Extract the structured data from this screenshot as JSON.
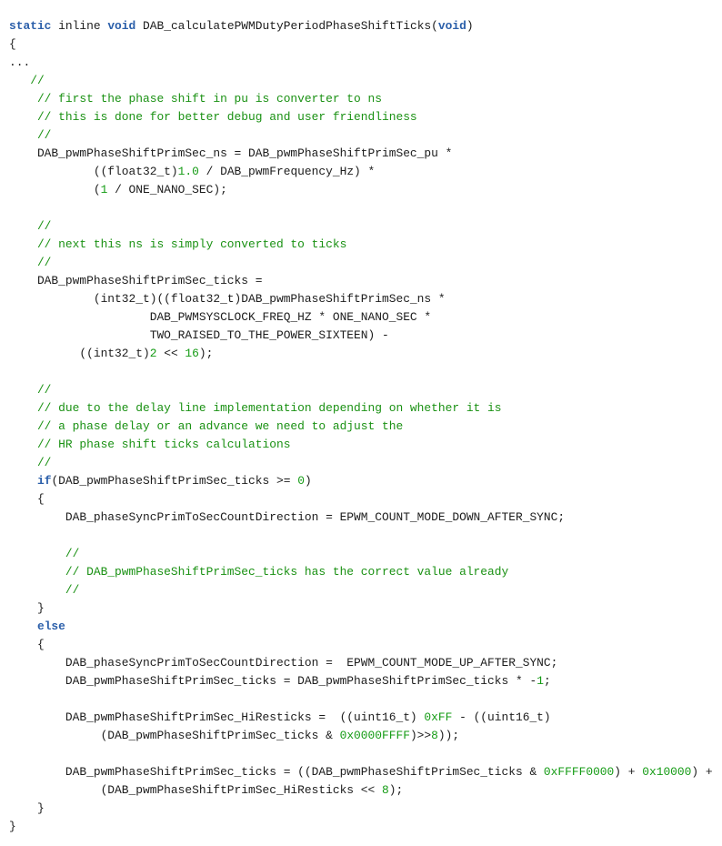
{
  "editor": {
    "language": "c",
    "function_name": "DAB_calculatePWMDutyPeriodPhaseShiftTicks",
    "background_color": "#ffffff",
    "colors": {
      "plain": "#1c1c1c",
      "keyword": "#2b5faa",
      "comment": "#1a9113",
      "number": "#149b14"
    }
  },
  "code": {
    "lines": [
      {
        "n": 1,
        "tokens": [
          {
            "t": "static",
            "c": "keyword"
          },
          {
            "t": " inline ",
            "c": "plain"
          },
          {
            "t": "void",
            "c": "keyword"
          },
          {
            "t": " DAB_calculatePWMDutyPeriodPhaseShiftTicks(",
            "c": "plain"
          },
          {
            "t": "void",
            "c": "keyword"
          },
          {
            "t": ")",
            "c": "plain"
          }
        ]
      },
      {
        "n": 2,
        "tokens": [
          {
            "t": "{",
            "c": "plain"
          }
        ]
      },
      {
        "n": 3,
        "tokens": [
          {
            "t": "...",
            "c": "plain"
          }
        ]
      },
      {
        "n": 4,
        "tokens": [
          {
            "t": "   //",
            "c": "comment"
          }
        ]
      },
      {
        "n": 5,
        "tokens": [
          {
            "t": "    // first the phase shift in pu is converter to ns",
            "c": "comment"
          }
        ]
      },
      {
        "n": 6,
        "tokens": [
          {
            "t": "    // this is done for better debug and user friendliness",
            "c": "comment"
          }
        ]
      },
      {
        "n": 7,
        "tokens": [
          {
            "t": "    //",
            "c": "comment"
          }
        ]
      },
      {
        "n": 8,
        "tokens": [
          {
            "t": "    DAB_pwmPhaseShiftPrimSec_ns = DAB_pwmPhaseShiftPrimSec_pu *",
            "c": "plain"
          }
        ]
      },
      {
        "n": 9,
        "tokens": [
          {
            "t": "            ((float32_t)",
            "c": "plain"
          },
          {
            "t": "1.0",
            "c": "number"
          },
          {
            "t": " / DAB_pwmFrequency_Hz) *",
            "c": "plain"
          }
        ]
      },
      {
        "n": 10,
        "tokens": [
          {
            "t": "            (",
            "c": "plain"
          },
          {
            "t": "1",
            "c": "number"
          },
          {
            "t": " / ONE_NANO_SEC);",
            "c": "plain"
          }
        ]
      },
      {
        "n": 11,
        "tokens": [
          {
            "t": "",
            "c": "plain"
          }
        ]
      },
      {
        "n": 12,
        "tokens": [
          {
            "t": "    //",
            "c": "comment"
          }
        ]
      },
      {
        "n": 13,
        "tokens": [
          {
            "t": "    // next this ns is simply converted to ticks",
            "c": "comment"
          }
        ]
      },
      {
        "n": 14,
        "tokens": [
          {
            "t": "    //",
            "c": "comment"
          }
        ]
      },
      {
        "n": 15,
        "tokens": [
          {
            "t": "    DAB_pwmPhaseShiftPrimSec_ticks =",
            "c": "plain"
          }
        ]
      },
      {
        "n": 16,
        "tokens": [
          {
            "t": "            (int32_t)((float32_t)DAB_pwmPhaseShiftPrimSec_ns *",
            "c": "plain"
          }
        ]
      },
      {
        "n": 17,
        "tokens": [
          {
            "t": "                    DAB_PWMSYSCLOCK_FREQ_HZ * ONE_NANO_SEC *",
            "c": "plain"
          }
        ]
      },
      {
        "n": 18,
        "tokens": [
          {
            "t": "                    TWO_RAISED_TO_THE_POWER_SIXTEEN) -",
            "c": "plain"
          }
        ]
      },
      {
        "n": 19,
        "tokens": [
          {
            "t": "          ((int32_t)",
            "c": "plain"
          },
          {
            "t": "2",
            "c": "number"
          },
          {
            "t": " << ",
            "c": "plain"
          },
          {
            "t": "16",
            "c": "number"
          },
          {
            "t": ");",
            "c": "plain"
          }
        ]
      },
      {
        "n": 20,
        "tokens": [
          {
            "t": "",
            "c": "plain"
          }
        ]
      },
      {
        "n": 21,
        "tokens": [
          {
            "t": "    //",
            "c": "comment"
          }
        ]
      },
      {
        "n": 22,
        "tokens": [
          {
            "t": "    // due to the delay line implementation depending on whether it is",
            "c": "comment"
          }
        ]
      },
      {
        "n": 23,
        "tokens": [
          {
            "t": "    // a phase delay or an advance we need to adjust the",
            "c": "comment"
          }
        ]
      },
      {
        "n": 24,
        "tokens": [
          {
            "t": "    // HR phase shift ticks calculations",
            "c": "comment"
          }
        ]
      },
      {
        "n": 25,
        "tokens": [
          {
            "t": "    //",
            "c": "comment"
          }
        ]
      },
      {
        "n": 26,
        "tokens": [
          {
            "t": "    ",
            "c": "plain"
          },
          {
            "t": "if",
            "c": "keyword"
          },
          {
            "t": "(DAB_pwmPhaseShiftPrimSec_ticks >= ",
            "c": "plain"
          },
          {
            "t": "0",
            "c": "number"
          },
          {
            "t": ")",
            "c": "plain"
          }
        ]
      },
      {
        "n": 27,
        "tokens": [
          {
            "t": "    {",
            "c": "plain"
          }
        ]
      },
      {
        "n": 28,
        "tokens": [
          {
            "t": "        DAB_phaseSyncPrimToSecCountDirection = EPWM_COUNT_MODE_DOWN_AFTER_SYNC;",
            "c": "plain"
          }
        ]
      },
      {
        "n": 29,
        "tokens": [
          {
            "t": "",
            "c": "plain"
          }
        ]
      },
      {
        "n": 30,
        "tokens": [
          {
            "t": "        //",
            "c": "comment"
          }
        ]
      },
      {
        "n": 31,
        "tokens": [
          {
            "t": "        // DAB_pwmPhaseShiftPrimSec_ticks has the correct value already",
            "c": "comment"
          }
        ]
      },
      {
        "n": 32,
        "tokens": [
          {
            "t": "        //",
            "c": "comment"
          }
        ]
      },
      {
        "n": 33,
        "tokens": [
          {
            "t": "    }",
            "c": "plain"
          }
        ]
      },
      {
        "n": 34,
        "tokens": [
          {
            "t": "    ",
            "c": "plain"
          },
          {
            "t": "else",
            "c": "keyword"
          }
        ]
      },
      {
        "n": 35,
        "tokens": [
          {
            "t": "    {",
            "c": "plain"
          }
        ]
      },
      {
        "n": 36,
        "tokens": [
          {
            "t": "        DAB_phaseSyncPrimToSecCountDirection =  EPWM_COUNT_MODE_UP_AFTER_SYNC;",
            "c": "plain"
          }
        ]
      },
      {
        "n": 37,
        "tokens": [
          {
            "t": "        DAB_pwmPhaseShiftPrimSec_ticks = DAB_pwmPhaseShiftPrimSec_ticks * -",
            "c": "plain"
          },
          {
            "t": "1",
            "c": "number"
          },
          {
            "t": ";",
            "c": "plain"
          }
        ]
      },
      {
        "n": 38,
        "tokens": [
          {
            "t": "",
            "c": "plain"
          }
        ]
      },
      {
        "n": 39,
        "tokens": [
          {
            "t": "        DAB_pwmPhaseShiftPrimSec_HiResticks =  ((uint16_t) ",
            "c": "plain"
          },
          {
            "t": "0xFF",
            "c": "number"
          },
          {
            "t": " - ((uint16_t)",
            "c": "plain"
          }
        ]
      },
      {
        "n": 40,
        "tokens": [
          {
            "t": "             (DAB_pwmPhaseShiftPrimSec_ticks & ",
            "c": "plain"
          },
          {
            "t": "0x0000FFFF",
            "c": "number"
          },
          {
            "t": ")>>",
            "c": "plain"
          },
          {
            "t": "8",
            "c": "number"
          },
          {
            "t": "));",
            "c": "plain"
          }
        ]
      },
      {
        "n": 41,
        "tokens": [
          {
            "t": "",
            "c": "plain"
          }
        ]
      },
      {
        "n": 42,
        "tokens": [
          {
            "t": "        DAB_pwmPhaseShiftPrimSec_ticks = ((DAB_pwmPhaseShiftPrimSec_ticks & ",
            "c": "plain"
          },
          {
            "t": "0xFFFF0000",
            "c": "number"
          },
          {
            "t": ") + ",
            "c": "plain"
          },
          {
            "t": "0x10000",
            "c": "number"
          },
          {
            "t": ") +",
            "c": "plain"
          }
        ]
      },
      {
        "n": 43,
        "tokens": [
          {
            "t": "             (DAB_pwmPhaseShiftPrimSec_HiResticks << ",
            "c": "plain"
          },
          {
            "t": "8",
            "c": "number"
          },
          {
            "t": ");",
            "c": "plain"
          }
        ]
      },
      {
        "n": 44,
        "tokens": [
          {
            "t": "    }",
            "c": "plain"
          }
        ]
      },
      {
        "n": 45,
        "tokens": [
          {
            "t": "}",
            "c": "plain"
          }
        ]
      }
    ]
  }
}
